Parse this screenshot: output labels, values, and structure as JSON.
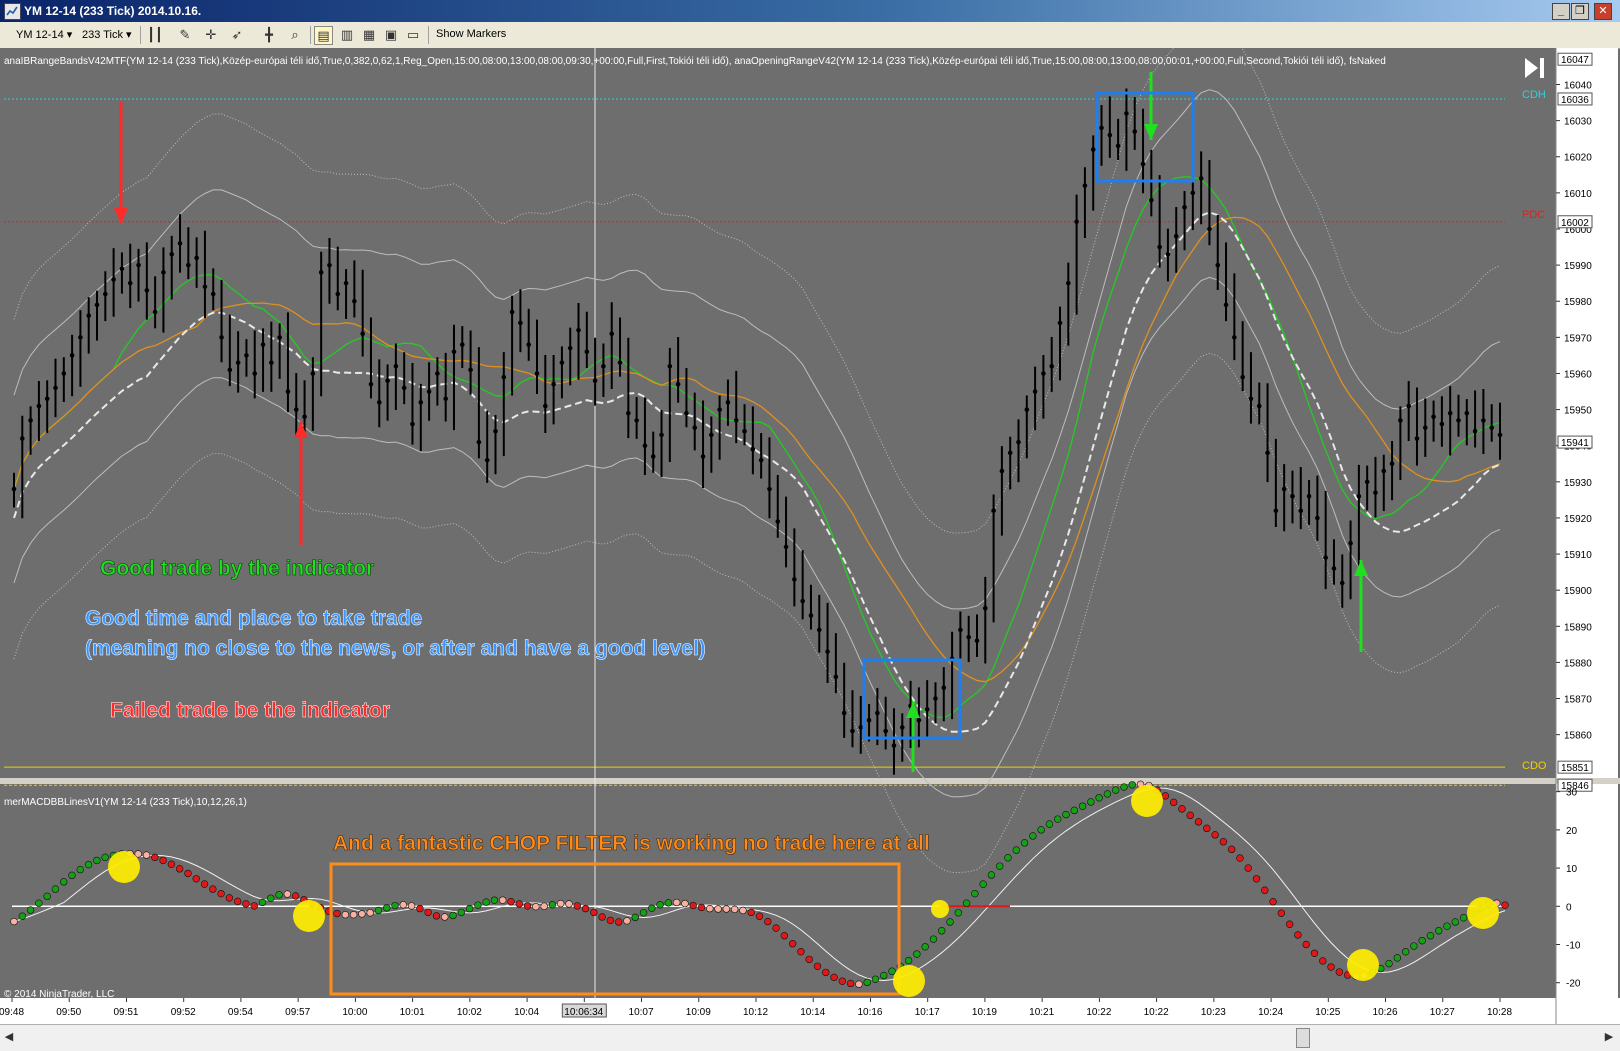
{
  "window": {
    "title": "YM 12-14 (233 Tick)  2014.10.16."
  },
  "toolbar": {
    "instrument": "YM 12-14",
    "interval": "233 Tick",
    "show_markers": "Show Markers"
  },
  "price_panel": {
    "indicator_label": "anaIBRangeBandsV42MTF(YM 12-14 (233 Tick),Közép-európai téli idő,True,0,382,0,62,1,Reg_Open,15:00,08:00,13:00,08:00,09:30,+00:00,Full,First,Tokiói téli idő), anaOpeningRangeV42(YM 12-14 (233 Tick),Közép-európai téli idő,True,15:00,08:00,13:00,08:00,00:01,+00:00,Full,Second,Tokiói téli idő), fsNaked",
    "axis_ticks": [
      16040,
      16030,
      16020,
      16010,
      16000,
      15990,
      15980,
      15970,
      15960,
      15950,
      15940,
      15930,
      15920,
      15910,
      15900,
      15890,
      15880,
      15870,
      15860
    ],
    "price_boxes": [
      "16047",
      "16036",
      "16002",
      "15941",
      "15851",
      "15846"
    ],
    "level_labels": {
      "cdh": "CDH",
      "pdc": "PDC",
      "cdo": "CDO"
    },
    "colors": {
      "cdh": "#2ed0e0",
      "pdc": "#e02020",
      "cdo": "#f0d000",
      "candle": "#000000",
      "band_green": "#22cc22",
      "band_orange": "#e09020",
      "band_gray": "#bdbdbd",
      "pivot_white": "#e8e8e8"
    }
  },
  "annotations": {
    "good_trade": "Good trade by the indicator",
    "good_time_line1": "Good time and place to take trade",
    "good_time_line2": "(meaning no close to the news, or after and have a good level)",
    "failed_trade": "Failed trade be the indicator",
    "chop_filter": "And a fantastic CHOP FILTER is working no trade here at all",
    "colors": {
      "good": "#1fe01f",
      "time": "#3c96ff",
      "failed": "#ff2a2a",
      "chop": "#ff8c1a",
      "box_blue": "#1e7ff0",
      "box_orange": "#ff8c1a",
      "signal": "#ffee00"
    }
  },
  "macd_panel": {
    "indicator_label": "merMACDBBLinesV1(YM 12-14 (233 Tick),10,12,26,1)",
    "axis_ticks": [
      30,
      20,
      10,
      0,
      -10,
      -20
    ],
    "ylim": [
      -24,
      32
    ],
    "colors": {
      "up_dot": "#16a016",
      "down_dot": "#e01818",
      "light_dot": "#f8b0a0"
    }
  },
  "time_axis": {
    "labels": [
      "09:48",
      "09:50",
      "09:51",
      "09:52",
      "09:54",
      "09:57",
      "10:00",
      "10:01",
      "10:02",
      "10:04",
      "10:06:34",
      "10:07",
      "10:09",
      "10:12",
      "10:14",
      "10:16",
      "10:17",
      "10:19",
      "10:21",
      "10:22",
      "10:22",
      "10:23",
      "10:24",
      "10:25",
      "10:26",
      "10:27",
      "10:28"
    ],
    "cursor_label": "10:06:34"
  },
  "copyright": "© 2014 NinjaTrader, LLC",
  "chart_data": {
    "type": "candlestick",
    "y_axis_range": [
      15848,
      16049
    ],
    "closes": [
      15928,
      15942,
      15947,
      15951,
      15953,
      15956,
      15960,
      15965,
      15970,
      15976,
      15979,
      15982,
      15986,
      15989,
      15985,
      15990,
      15983,
      15977,
      15988,
      15993,
      15996,
      15990,
      15992,
      15984,
      15982,
      15970,
      15961,
      15963,
      15965,
      15960,
      15968,
      15963,
      15970,
      15955,
      15950,
      15948,
      15960,
      15988,
      15990,
      15982,
      15985,
      15980,
      15971,
      15957,
      15952,
      15958,
      15962,
      15956,
      15946,
      15952,
      15955,
      15960,
      15953,
      15966,
      15968,
      15961,
      15941,
      15936,
      15944,
      15959,
      15977,
      15974,
      15968,
      15960,
      15951,
      15957,
      15963,
      15967,
      15972,
      15966,
      15958,
      15962,
      15971,
      15963,
      15949,
      15947,
      15940,
      15937,
      15943,
      15962,
      15957,
      15949,
      15945,
      15937,
      15943,
      15950,
      15952,
      15947,
      15944,
      15939,
      15936,
      15928,
      15919,
      15912,
      15903,
      15897,
      15893,
      15889,
      15883,
      15876,
      15866,
      15861,
      15862,
      15864,
      15866,
      15861,
      15857,
      15862,
      15868,
      15864,
      15867,
      15870,
      15873,
      15881,
      15889,
      15887,
      15886,
      15895,
      15922,
      15933,
      15938,
      15941,
      15950,
      15955,
      15960,
      15962,
      15974,
      15985,
      16002,
      16012,
      16022,
      16028,
      16026,
      16023,
      16032,
      16027,
      16018,
      16008,
      15995,
      15993,
      15998,
      16006,
      16010,
      16014,
      16000,
      15990,
      15979,
      15970,
      15959,
      15953,
      15951,
      15938,
      15922,
      15928,
      15926,
      15922,
      15926,
      15920,
      15909,
      15906,
      15902,
      15913,
      15926,
      15930,
      15927,
      15933,
      15935,
      15947,
      15951,
      15942,
      15945,
      15948,
      15946,
      15949,
      15947,
      15949,
      15944,
      15947,
      15945,
      15943
    ],
    "series": [
      {
        "name": "macd",
        "type": "dots",
        "values": [
          -4,
          -2.6,
          -1,
          0.8,
          2.6,
          4.5,
          6.4,
          8.1,
          9.6,
          10.9,
          12,
          12.8,
          13.3,
          13.7,
          13.8,
          13.7,
          13.4,
          12.8,
          12,
          11,
          9.8,
          8.6,
          7.2,
          5.8,
          4.5,
          3.3,
          2.2,
          1.3,
          0.6,
          0.1,
          1,
          2.1,
          3,
          3.2,
          2.7,
          1.7,
          0.6,
          -0.4,
          -1.3,
          -1.9,
          -2.2,
          -2.2,
          -2,
          -1.7,
          -1.1,
          -0.4,
          0.2,
          0.4,
          0.1,
          -0.6,
          -1.6,
          -2.5,
          -2.8,
          -2.4,
          -1.6,
          -0.6,
          0.3,
          1.1,
          1.6,
          1.6,
          1.2,
          0.6,
          0.1,
          -0.1,
          0,
          0.4,
          0.7,
          0.6,
          0.1,
          -0.6,
          -1.6,
          -2.8,
          -3.7,
          -4.1,
          -3.8,
          -2.9,
          -1.7,
          -0.5,
          0.4,
          0.9,
          1,
          0.7,
          0.2,
          -0.3,
          -0.6,
          -0.7,
          -0.7,
          -0.8,
          -1.1,
          -1.6,
          -2.6,
          -4,
          -5.7,
          -7.7,
          -9.8,
          -11.9,
          -13.9,
          -15.7,
          -17.3,
          -18.6,
          -19.6,
          -20.2,
          -20.4,
          -19.9,
          -19.1,
          -18.1,
          -17,
          -15.7,
          -14.2,
          -12.5,
          -10.6,
          -8.6,
          -6.4,
          -4.1,
          -1.7,
          0.8,
          3.3,
          5.8,
          8.2,
          10.5,
          12.7,
          14.7,
          16.6,
          18.4,
          20,
          21.5,
          22.8,
          24,
          25.1,
          26.2,
          27.3,
          28.4,
          29.4,
          30.4,
          31.2,
          31.8,
          31.9,
          31.6,
          30.4,
          28.9,
          27.2,
          25.5,
          23.8,
          22.1,
          20.4,
          18.7,
          16.9,
          14.9,
          12.6,
          10,
          7.2,
          4.2,
          1.2,
          -1.8,
          -4.7,
          -7.5,
          -10,
          -12.3,
          -14.3,
          -15.9,
          -17.2,
          -18,
          -18.3,
          -18.1,
          -17.4,
          -16.3,
          -15,
          -13.5,
          -11.9,
          -10.4,
          -9,
          -7.7,
          -6.4,
          -5.2,
          -4.1,
          -3,
          -1.8,
          -0.6,
          0.5,
          0.8,
          0.3
        ]
      }
    ]
  }
}
